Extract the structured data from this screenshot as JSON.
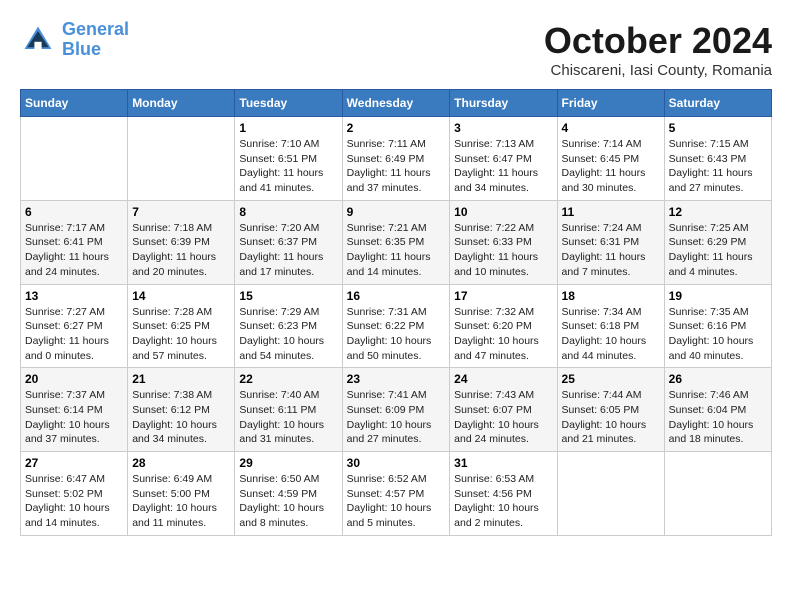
{
  "logo": {
    "line1": "General",
    "line2": "Blue"
  },
  "title": "October 2024",
  "location": "Chiscareni, Iasi County, Romania",
  "days_of_week": [
    "Sunday",
    "Monday",
    "Tuesday",
    "Wednesday",
    "Thursday",
    "Friday",
    "Saturday"
  ],
  "weeks": [
    [
      {
        "day": "",
        "detail": ""
      },
      {
        "day": "",
        "detail": ""
      },
      {
        "day": "1",
        "detail": "Sunrise: 7:10 AM\nSunset: 6:51 PM\nDaylight: 11 hours and 41 minutes."
      },
      {
        "day": "2",
        "detail": "Sunrise: 7:11 AM\nSunset: 6:49 PM\nDaylight: 11 hours and 37 minutes."
      },
      {
        "day": "3",
        "detail": "Sunrise: 7:13 AM\nSunset: 6:47 PM\nDaylight: 11 hours and 34 minutes."
      },
      {
        "day": "4",
        "detail": "Sunrise: 7:14 AM\nSunset: 6:45 PM\nDaylight: 11 hours and 30 minutes."
      },
      {
        "day": "5",
        "detail": "Sunrise: 7:15 AM\nSunset: 6:43 PM\nDaylight: 11 hours and 27 minutes."
      }
    ],
    [
      {
        "day": "6",
        "detail": "Sunrise: 7:17 AM\nSunset: 6:41 PM\nDaylight: 11 hours and 24 minutes."
      },
      {
        "day": "7",
        "detail": "Sunrise: 7:18 AM\nSunset: 6:39 PM\nDaylight: 11 hours and 20 minutes."
      },
      {
        "day": "8",
        "detail": "Sunrise: 7:20 AM\nSunset: 6:37 PM\nDaylight: 11 hours and 17 minutes."
      },
      {
        "day": "9",
        "detail": "Sunrise: 7:21 AM\nSunset: 6:35 PM\nDaylight: 11 hours and 14 minutes."
      },
      {
        "day": "10",
        "detail": "Sunrise: 7:22 AM\nSunset: 6:33 PM\nDaylight: 11 hours and 10 minutes."
      },
      {
        "day": "11",
        "detail": "Sunrise: 7:24 AM\nSunset: 6:31 PM\nDaylight: 11 hours and 7 minutes."
      },
      {
        "day": "12",
        "detail": "Sunrise: 7:25 AM\nSunset: 6:29 PM\nDaylight: 11 hours and 4 minutes."
      }
    ],
    [
      {
        "day": "13",
        "detail": "Sunrise: 7:27 AM\nSunset: 6:27 PM\nDaylight: 11 hours and 0 minutes."
      },
      {
        "day": "14",
        "detail": "Sunrise: 7:28 AM\nSunset: 6:25 PM\nDaylight: 10 hours and 57 minutes."
      },
      {
        "day": "15",
        "detail": "Sunrise: 7:29 AM\nSunset: 6:23 PM\nDaylight: 10 hours and 54 minutes."
      },
      {
        "day": "16",
        "detail": "Sunrise: 7:31 AM\nSunset: 6:22 PM\nDaylight: 10 hours and 50 minutes."
      },
      {
        "day": "17",
        "detail": "Sunrise: 7:32 AM\nSunset: 6:20 PM\nDaylight: 10 hours and 47 minutes."
      },
      {
        "day": "18",
        "detail": "Sunrise: 7:34 AM\nSunset: 6:18 PM\nDaylight: 10 hours and 44 minutes."
      },
      {
        "day": "19",
        "detail": "Sunrise: 7:35 AM\nSunset: 6:16 PM\nDaylight: 10 hours and 40 minutes."
      }
    ],
    [
      {
        "day": "20",
        "detail": "Sunrise: 7:37 AM\nSunset: 6:14 PM\nDaylight: 10 hours and 37 minutes."
      },
      {
        "day": "21",
        "detail": "Sunrise: 7:38 AM\nSunset: 6:12 PM\nDaylight: 10 hours and 34 minutes."
      },
      {
        "day": "22",
        "detail": "Sunrise: 7:40 AM\nSunset: 6:11 PM\nDaylight: 10 hours and 31 minutes."
      },
      {
        "day": "23",
        "detail": "Sunrise: 7:41 AM\nSunset: 6:09 PM\nDaylight: 10 hours and 27 minutes."
      },
      {
        "day": "24",
        "detail": "Sunrise: 7:43 AM\nSunset: 6:07 PM\nDaylight: 10 hours and 24 minutes."
      },
      {
        "day": "25",
        "detail": "Sunrise: 7:44 AM\nSunset: 6:05 PM\nDaylight: 10 hours and 21 minutes."
      },
      {
        "day": "26",
        "detail": "Sunrise: 7:46 AM\nSunset: 6:04 PM\nDaylight: 10 hours and 18 minutes."
      }
    ],
    [
      {
        "day": "27",
        "detail": "Sunrise: 6:47 AM\nSunset: 5:02 PM\nDaylight: 10 hours and 14 minutes."
      },
      {
        "day": "28",
        "detail": "Sunrise: 6:49 AM\nSunset: 5:00 PM\nDaylight: 10 hours and 11 minutes."
      },
      {
        "day": "29",
        "detail": "Sunrise: 6:50 AM\nSunset: 4:59 PM\nDaylight: 10 hours and 8 minutes."
      },
      {
        "day": "30",
        "detail": "Sunrise: 6:52 AM\nSunset: 4:57 PM\nDaylight: 10 hours and 5 minutes."
      },
      {
        "day": "31",
        "detail": "Sunrise: 6:53 AM\nSunset: 4:56 PM\nDaylight: 10 hours and 2 minutes."
      },
      {
        "day": "",
        "detail": ""
      },
      {
        "day": "",
        "detail": ""
      }
    ]
  ]
}
